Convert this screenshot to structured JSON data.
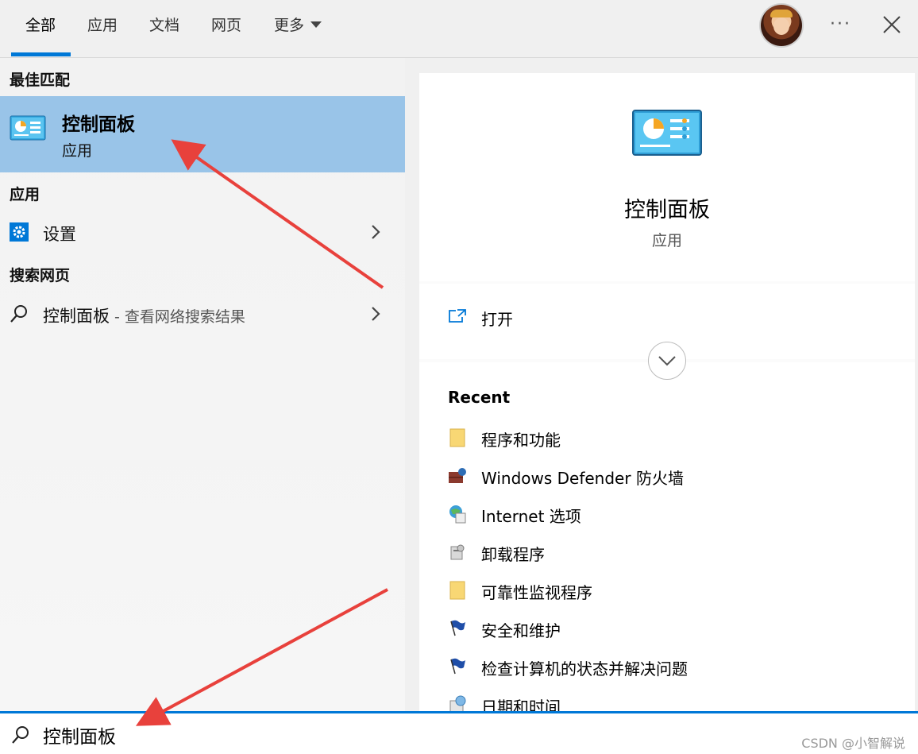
{
  "tabs": [
    {
      "label": "全部",
      "active": true
    },
    {
      "label": "应用"
    },
    {
      "label": "文档"
    },
    {
      "label": "网页"
    },
    {
      "label": "更多"
    }
  ],
  "header": {
    "more_icon": "more-dots-icon",
    "close_icon": "close-icon"
  },
  "left": {
    "best_match_heading": "最佳匹配",
    "best_match": {
      "title": "控制面板",
      "subtitle": "应用",
      "icon": "control-panel-icon"
    },
    "apps_heading": "应用",
    "apps": [
      {
        "label": "设置",
        "icon": "gear-icon"
      }
    ],
    "web_heading": "搜索网页",
    "web": [
      {
        "label": "控制面板",
        "desc": " - 查看网络搜索结果",
        "icon": "search-icon"
      }
    ]
  },
  "right": {
    "title": "控制面板",
    "subtitle": "应用",
    "open_label": "打开",
    "recent_heading": "Recent",
    "recent": [
      {
        "label": "程序和功能",
        "icon": "folder-icon"
      },
      {
        "label": "Windows Defender 防火墙",
        "icon": "firewall-icon"
      },
      {
        "label": "Internet 选项",
        "icon": "globe-icon"
      },
      {
        "label": "卸载程序",
        "icon": "uninstall-icon"
      },
      {
        "label": "可靠性监视程序",
        "icon": "folder-icon"
      },
      {
        "label": "安全和维护",
        "icon": "flag-icon"
      },
      {
        "label": "检查计算机的状态并解决问题",
        "icon": "flag-icon"
      },
      {
        "label": "日期和时间",
        "icon": "clock-icon"
      }
    ]
  },
  "search": {
    "value": "控制面板"
  },
  "watermark": "CSDN @小智解说",
  "colors": {
    "accent": "#0078d7",
    "selection": "#99c4e8",
    "arrow": "#e8413c"
  }
}
